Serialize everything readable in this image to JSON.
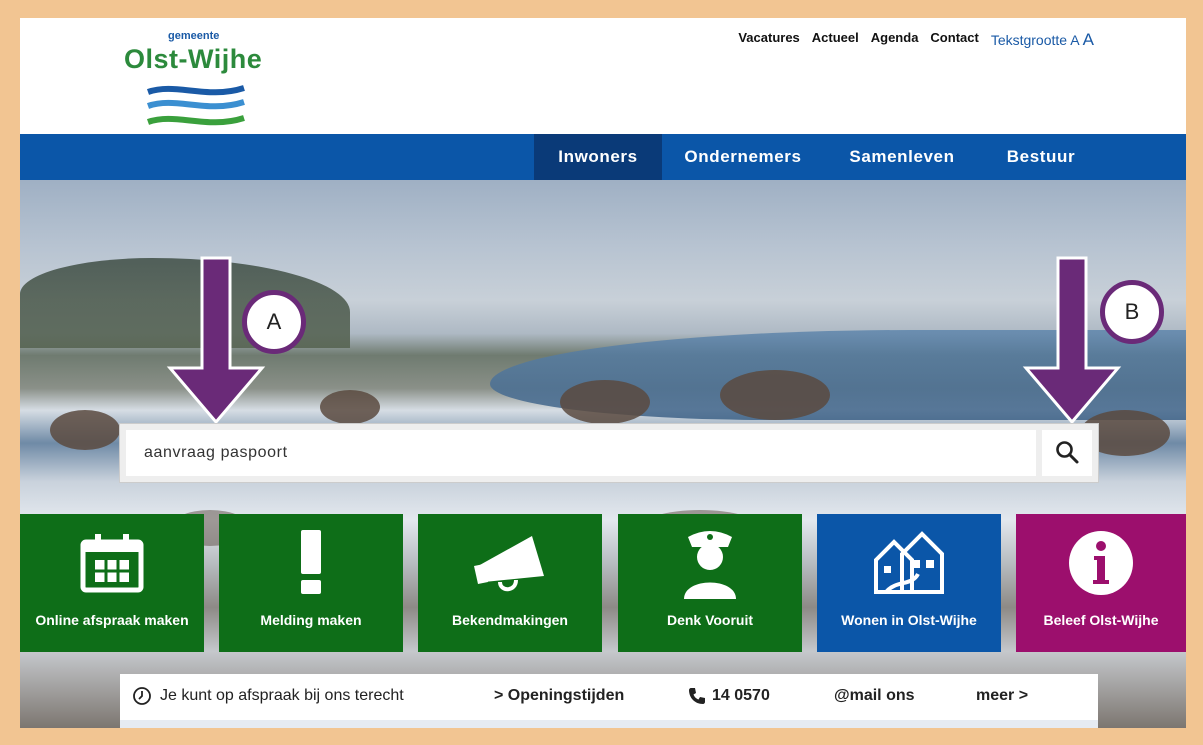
{
  "header": {
    "logo_small": "gemeente",
    "logo_main": "Olst-Wijhe",
    "top_links": [
      "Vacatures",
      "Actueel",
      "Agenda",
      "Contact"
    ],
    "text_size_label": "Tekstgrootte A",
    "text_size_large": "A"
  },
  "mainnav": {
    "items": [
      "Inwoners",
      "Ondernemers",
      "Samenleven",
      "Bestuur"
    ],
    "active": "Inwoners"
  },
  "annotations": {
    "a": "A",
    "b": "B"
  },
  "search": {
    "value": "aanvraag paspoort"
  },
  "tiles": [
    {
      "label": "Online afspraak maken",
      "icon": "calendar-icon",
      "color": "#0e6e18"
    },
    {
      "label": "Melding maken",
      "icon": "exclamation-icon",
      "color": "#0e6e18"
    },
    {
      "label": "Bekendmakingen",
      "icon": "megaphone-icon",
      "color": "#0e6e18"
    },
    {
      "label": "Denk Vooruit",
      "icon": "police-officer-icon",
      "color": "#0e6e18"
    },
    {
      "label": "Wonen in Olst-Wijhe",
      "icon": "houses-icon",
      "color": "#0b56a8"
    },
    {
      "label": "Beleef Olst-Wijhe",
      "icon": "info-icon",
      "color": "#9c0f6d"
    }
  ],
  "infobar": {
    "appointment_text": "Je kunt op afspraak bij ons terecht",
    "opening_hours": "> Openingstijden",
    "phone": "14 0570",
    "mail": "@mail ons",
    "more": "meer >"
  },
  "colors": {
    "nav_blue": "#0b56a8",
    "nav_active": "#0a3a78",
    "tile_green": "#0e6e18",
    "tile_purple": "#9c0f6d",
    "marker_purple": "#6a2a78",
    "frame_border": "#f2c592"
  }
}
